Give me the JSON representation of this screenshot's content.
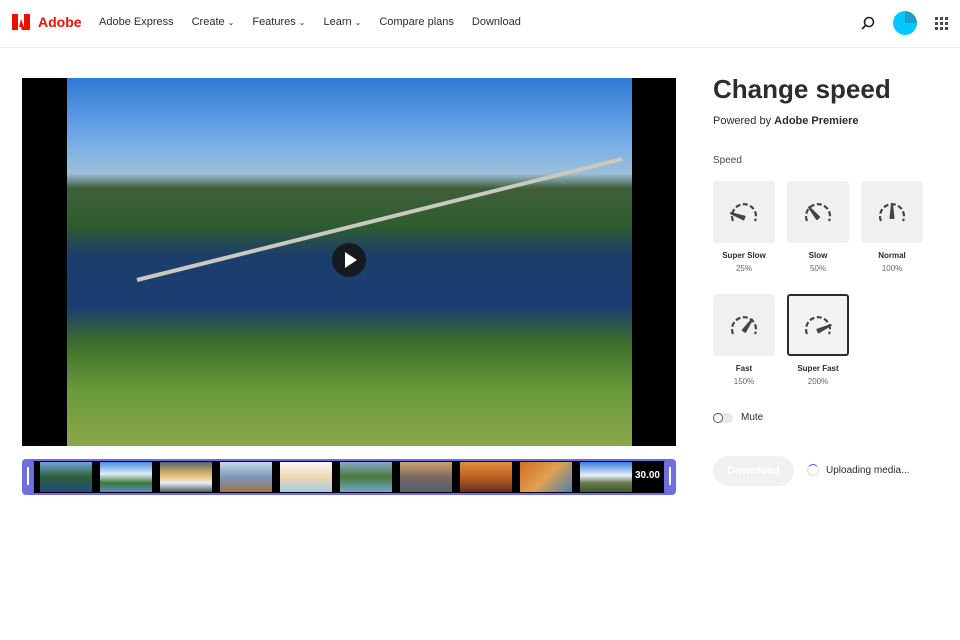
{
  "nav": {
    "brand": "Adobe",
    "items": [
      {
        "label": "Adobe Express",
        "dropdown": false
      },
      {
        "label": "Create",
        "dropdown": true
      },
      {
        "label": "Features",
        "dropdown": true
      },
      {
        "label": "Learn",
        "dropdown": true
      },
      {
        "label": "Compare plans",
        "dropdown": false
      },
      {
        "label": "Download",
        "dropdown": false
      }
    ]
  },
  "panel": {
    "title": "Change speed",
    "powered_prefix": "Powered by ",
    "powered_brand": "Adobe Premiere",
    "speed_label": "Speed",
    "options": [
      {
        "label": "Super Slow",
        "pct": "25%"
      },
      {
        "label": "Slow",
        "pct": "50%"
      },
      {
        "label": "Normal",
        "pct": "100%"
      },
      {
        "label": "Fast",
        "pct": "150%"
      },
      {
        "label": "Super Fast",
        "pct": "200%",
        "selected": true
      }
    ],
    "mute_label": "Mute",
    "mute_on": false,
    "download_label": "Download",
    "status": "Uploading media..."
  },
  "timeline": {
    "duration": "30.00"
  },
  "colors": {
    "brand": "#eb1000",
    "accent": "#6e6ee0"
  }
}
